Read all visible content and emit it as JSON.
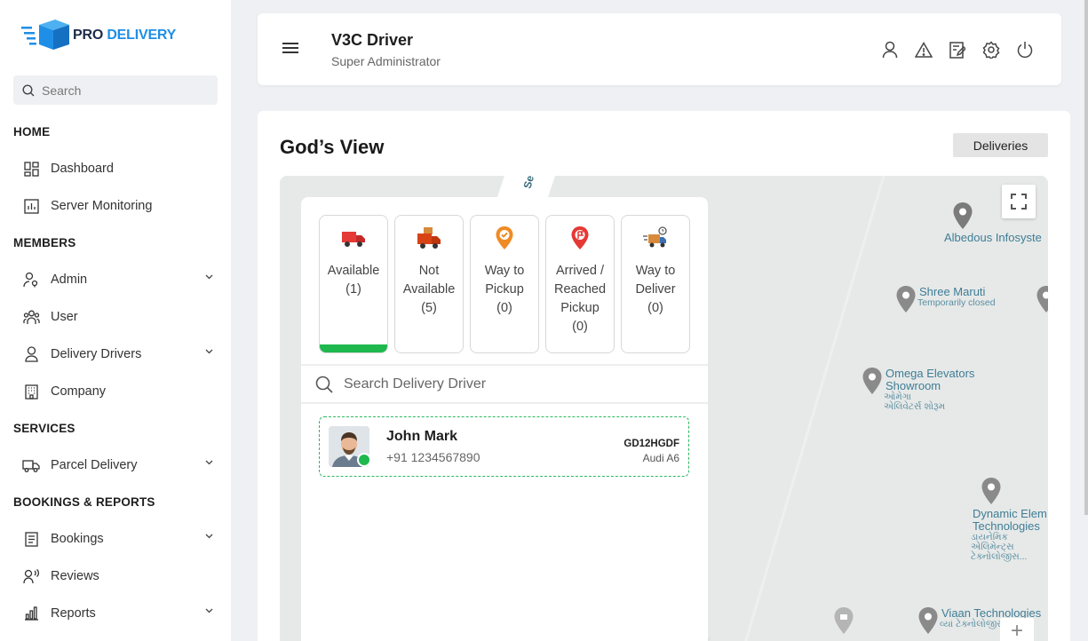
{
  "brand": {
    "pro": "PRO",
    "delivery": "DELIVERY"
  },
  "sidebar": {
    "search_placeholder": "Search",
    "sections": {
      "home": "HOME",
      "members": "MEMBERS",
      "services": "SERVICES",
      "bookings_reports": "BOOKINGS & REPORTS"
    },
    "items": {
      "dashboard": "Dashboard",
      "server_monitoring": "Server Monitoring",
      "admin": "Admin",
      "user": "User",
      "delivery_drivers": "Delivery Drivers",
      "company": "Company",
      "parcel_delivery": "Parcel Delivery",
      "bookings": "Bookings",
      "reviews": "Reviews",
      "reports": "Reports"
    }
  },
  "header": {
    "title": "V3C Driver",
    "subtitle": "Super Administrator",
    "icons": [
      "user-icon",
      "warning-icon",
      "edit-icon",
      "settings-icon",
      "power-icon"
    ]
  },
  "main": {
    "title": "God’s View",
    "deliveries_button": "Deliveries",
    "map_tab_text": "Se",
    "statuses": [
      {
        "line1": "Available",
        "line2": "(1)",
        "line3": "",
        "line4": "",
        "icon": "truck-icon",
        "active": true
      },
      {
        "line1": "Not",
        "line2": "Available",
        "line3": "(5)",
        "line4": "",
        "icon": "truck-box-icon",
        "active": false
      },
      {
        "line1": "Way to",
        "line2": "Pickup",
        "line3": "(0)",
        "line4": "",
        "icon": "pickup-pin-icon",
        "active": false
      },
      {
        "line1": "Arrived /",
        "line2": "Reached",
        "line3": "Pickup",
        "line4": "(0)",
        "icon": "flag-pin-icon",
        "active": false
      },
      {
        "line1": "Way to",
        "line2": "Deliver",
        "line3": "(0)",
        "line4": "",
        "icon": "delivery-truck-icon",
        "active": false
      }
    ],
    "driver_search_placeholder": "Search Delivery Driver",
    "driver": {
      "name": "John Mark",
      "phone": "+91 1234567890",
      "plate": "GD12HGDF",
      "car": "Audi A6"
    },
    "map_pois": {
      "albedous": "Albedous Infosyste",
      "shree": "Shree Maruti",
      "shree_sub": "Temporarily closed",
      "omega1": "Omega Elevators",
      "omega2": "Showroom",
      "omega_sub1": "ઓમેગા",
      "omega_sub2": "એલિવેટર્સ શોરૂમ",
      "dynamic1": "Dynamic Elem",
      "dynamic2": "Technologies",
      "dynamic_sub1": "ડાયનેમિક એલિમેન્ટ્સ",
      "dynamic_sub2": "ટેક્નોલોજીસ...",
      "viaan": "Viaan Technologies",
      "viaan_sub": "વ્યાં ટેક્નોલોજીસ"
    }
  },
  "colors": {
    "accent": "#1f8ee6",
    "active_green": "#1fb84e",
    "brand_dark": "#1c2b4a"
  }
}
